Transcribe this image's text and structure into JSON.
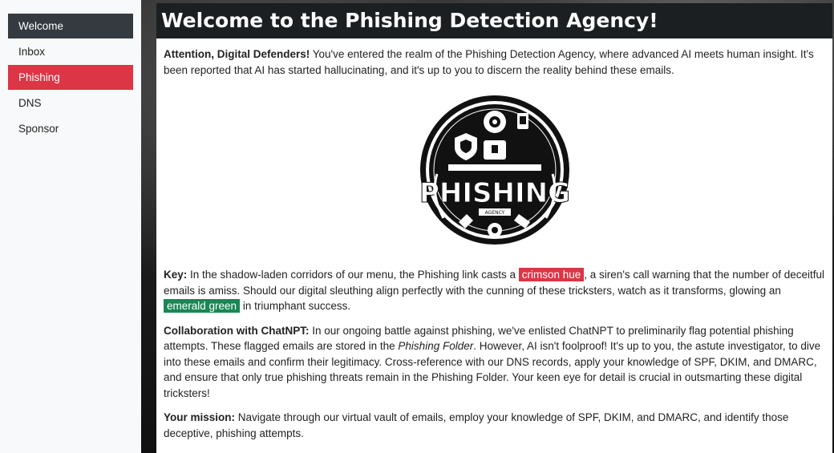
{
  "sidebar": {
    "items": [
      {
        "label": "Welcome"
      },
      {
        "label": "Inbox"
      },
      {
        "label": "Phishing"
      },
      {
        "label": "DNS"
      },
      {
        "label": "Sponsor"
      }
    ]
  },
  "header": {
    "title": "Welcome to the Phishing Detection Agency!"
  },
  "intro": {
    "lead": "Attention, Digital Defenders!",
    "text": " You've entered the realm of the Phishing Detection Agency, where advanced AI meets human insight. It's been reported that AI has started hallucinating, and it's up to you to discern the reality behind these emails."
  },
  "logo": {
    "text": "PHISHING",
    "subtext": "AGENCY"
  },
  "key": {
    "lead": "Key:",
    "text1": " In the shadow-laden corridors of our menu, the Phishing link casts a ",
    "crimson": "crimson hue",
    "text2": ", a siren's call warning that the number of deceitful emails is amiss. Should our digital sleuthing align perfectly with the cunning of these tricksters, watch as it transforms, glowing an ",
    "emerald": "emerald green",
    "text3": " in triumphant success."
  },
  "collab": {
    "lead": "Collaboration with ChatNPT:",
    "text1": " In our ongoing battle against phishing, we've enlisted ChatNPT to preliminarily flag potential phishing attempts. These flagged emails are stored in the ",
    "folder": "Phishing Folder",
    "text2": ". However, AI isn't foolproof! It's up to you, the astute investigator, to dive into these emails and confirm their legitimacy. Cross-reference with our DNS records, apply your knowledge of SPF, DKIM, and DMARC, and ensure that only true phishing threats remain in the Phishing Folder. Your keen eye for detail is crucial in outsmarting these digital tricksters!"
  },
  "mission": {
    "lead": "Your mission:",
    "text": " Navigate through our virtual vault of emails, employ your knowledge of SPF, DKIM, and DMARC, and identify those deceptive, phishing attempts."
  },
  "colors": {
    "crimson": "#dc3545",
    "emerald": "#198754",
    "active": "#343a40"
  }
}
